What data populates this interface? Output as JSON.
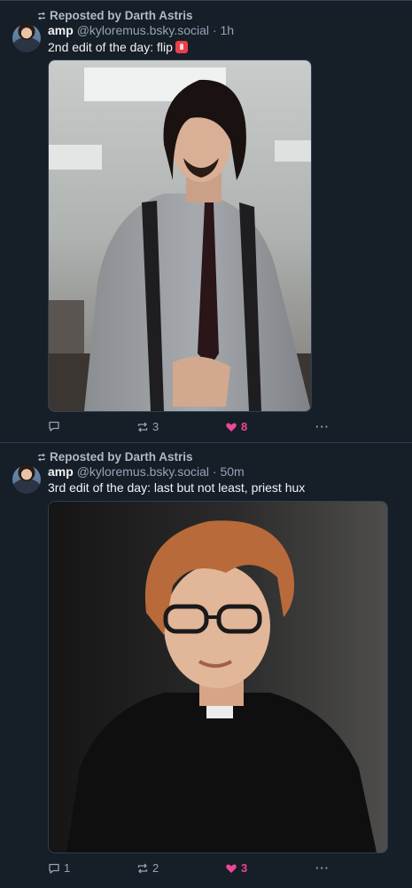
{
  "posts": [
    {
      "repost_label": "Reposted by Darth Astris",
      "author_name": "amp",
      "handle": "@kyloremus.bsky.social",
      "separator": "·",
      "time": "1h",
      "text": "2nd edit of the day: flip",
      "reply_count": "",
      "repost_count": "3",
      "like_count": "8",
      "more_label": "···"
    },
    {
      "repost_label": "Reposted by Darth Astris",
      "author_name": "amp",
      "handle": "@kyloremus.bsky.social",
      "separator": "·",
      "time": "50m",
      "text": "3rd edit of the day: last but not least, priest hux",
      "reply_count": "1",
      "repost_count": "2",
      "like_count": "3",
      "more_label": "···"
    }
  ],
  "colors": {
    "background": "#161e27",
    "divider": "#2e4052",
    "muted_text": "#93a5b7",
    "like_accent": "#ec4899"
  },
  "icons": [
    "repost-icon",
    "reply-icon",
    "heart-icon",
    "more-icon",
    "siren-emoji"
  ]
}
